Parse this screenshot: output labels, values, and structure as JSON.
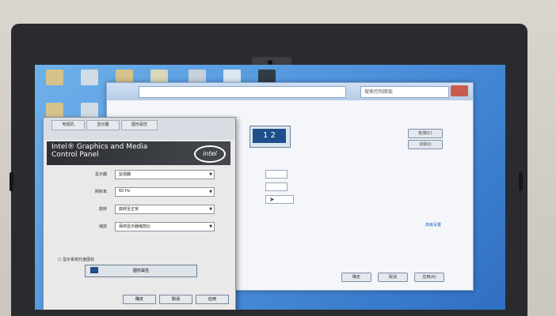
{
  "search": {
    "placeholder": "搜索控制面板"
  },
  "cp_buttons": {
    "detect": "检测(C)",
    "identify": "识别(I)",
    "ok": "确定",
    "cancel": "取消",
    "apply": "应用(A)"
  },
  "cp_link": {
    "advanced": "高级设置"
  },
  "monitor": {
    "label": "1 2"
  },
  "igfx": {
    "tab1": "电视机",
    "tab2": "显示器",
    "tab3": "图形属性",
    "title": "Intel® Graphics and Media Control Panel",
    "logo": "intel",
    "rows": [
      {
        "label": "显示器",
        "value": "监视器"
      },
      {
        "label": "刷新率",
        "value": "60 Hz"
      },
      {
        "label": "旋转",
        "value": "旋转至正常"
      },
      {
        "label": "缩放",
        "value": "保持显示器缩放比"
      }
    ],
    "checkbox": "显示系统托盘图标",
    "button": "图形属性",
    "footer": {
      "ok": "确定",
      "cancel": "取消",
      "apply": "应用"
    }
  }
}
